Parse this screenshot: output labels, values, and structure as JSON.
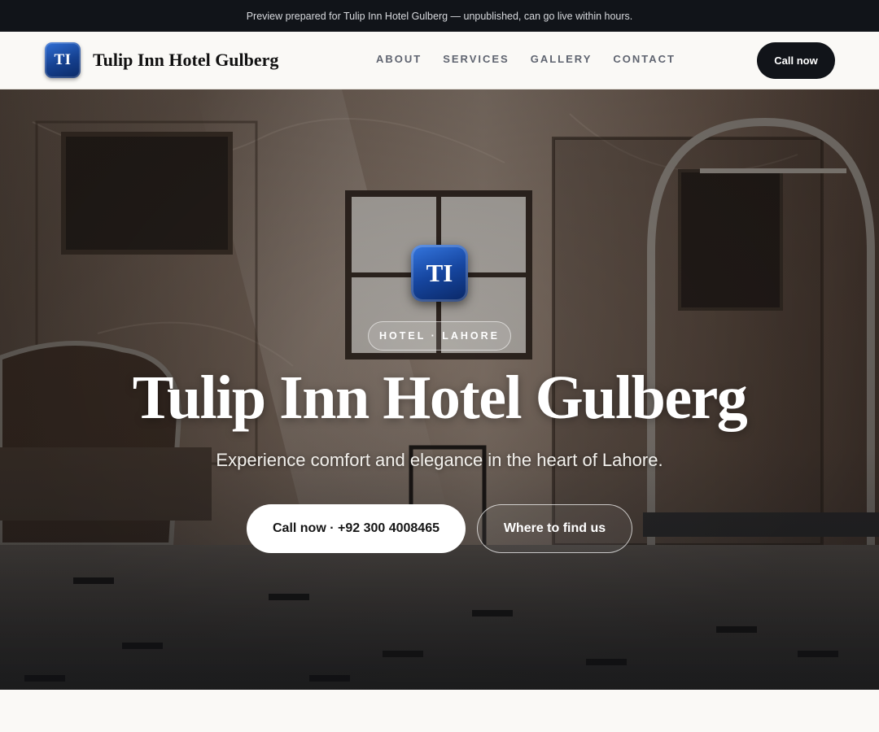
{
  "announcement": {
    "text": "Preview prepared for Tulip Inn Hotel Gulberg — unpublished, can go live within hours."
  },
  "header": {
    "logo_initials": "TI",
    "brand_name": "Tulip Inn Hotel Gulberg",
    "nav": [
      {
        "label": "ABOUT"
      },
      {
        "label": "SERVICES"
      },
      {
        "label": "GALLERY"
      },
      {
        "label": "CONTACT"
      }
    ],
    "cta_label": "Call now"
  },
  "hero": {
    "logo_initials": "TI",
    "badge": "HOTEL · LAHORE",
    "title": "Tulip Inn Hotel Gulberg",
    "subtitle": "Experience comfort and elegance in the heart of Lahore.",
    "primary_button": "Call now · +92 300 4008465",
    "secondary_button": "Where to find us",
    "background_image": "hotel-lobby-photo"
  },
  "colors": {
    "topbar_bg": "#111419",
    "brand_blue": "#15408f",
    "cta_dark": "#111419",
    "page_bg": "#faf9f6"
  }
}
